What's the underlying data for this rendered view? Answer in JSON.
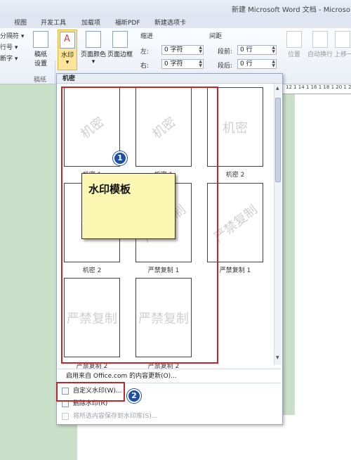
{
  "window": {
    "title": "新建 Microsoft Word 文档 - Microso"
  },
  "tabs": [
    "视图",
    "开发工具",
    "加载项",
    "福昕PDF",
    "新建选项卡"
  ],
  "ribbon": {
    "left_fragments": [
      "分隔符 ▾",
      "行号 ▾",
      "断字 ▾"
    ],
    "draft": {
      "label": "稿纸\n设置",
      "group": "稿纸"
    },
    "buttons": {
      "watermark": "水印",
      "page_color": "页面颜色",
      "page_border": "页面边框"
    },
    "indent": {
      "title": "缩进",
      "left_label": "左:",
      "left_value": "0 字符",
      "right_label": "右:",
      "right_value": "0 字符"
    },
    "spacing": {
      "title": "间距",
      "before_label": "段前:",
      "before_value": "0 行",
      "after_label": "段后:",
      "after_value": "0 行"
    },
    "arrange": {
      "position": "位置",
      "wrap": "自动换行",
      "forward": "上移一"
    }
  },
  "ruler": {
    "text": "12 1 14 1 16 1 18 1 20 1 22"
  },
  "gallery": {
    "header": "机密",
    "items": [
      {
        "watermark": "机密",
        "caption": "机密 1",
        "style": "diagonal"
      },
      {
        "watermark": "机密",
        "caption": "机密 1",
        "style": "diagonal"
      },
      {
        "watermark": "机密",
        "caption": "机密 2",
        "style": "horizontal"
      },
      {
        "watermark": "机密",
        "caption": "机密 2",
        "style": "diagonal"
      },
      {
        "watermark": "严禁复制",
        "caption": "严禁复制 1",
        "style": "diagonal"
      },
      {
        "watermark": "严禁复制",
        "caption": "严禁复制 1",
        "style": "diagonal"
      },
      {
        "watermark": "严禁复制",
        "caption": "严禁复制 2",
        "style": "horizontal"
      },
      {
        "watermark": "严禁复制",
        "caption": "严禁复制 2",
        "style": "horizontal"
      }
    ]
  },
  "menu": {
    "office_update": "启用来自 Office.com 的内容更新(O)...",
    "custom": "自定义水印(W)...",
    "remove": "删除水印(R)",
    "save_selection": "将所选内容保存到水印库(S)..."
  },
  "annotations": {
    "note": "水印模板",
    "badge1": "1",
    "badge2": "2"
  },
  "colors": {
    "highlight": "#c0272d",
    "badge": "#1f4ea8",
    "note": "#fbf7b2",
    "doc_bg": "#c8dfc8"
  }
}
